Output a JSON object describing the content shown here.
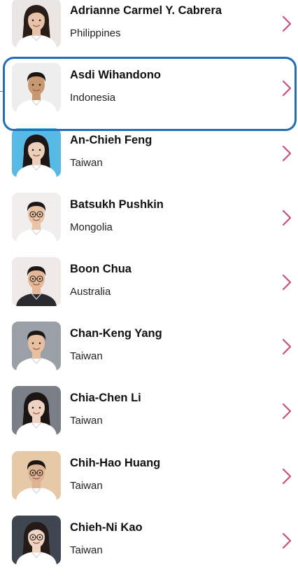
{
  "people": [
    {
      "name": "Adrianne Carmel Y. Cabrera",
      "country": "Philippines",
      "bg": "#e9e6e4",
      "skin": "#e6c3a9",
      "hair": "#2a1d18",
      "shirt": "#ffffff",
      "longhair": true,
      "glasses": false
    },
    {
      "name": "Asdi Wihandono",
      "country": "Indonesia",
      "bg": "#eeeeee",
      "skin": "#c89870",
      "hair": "#1a1413",
      "shirt": "#ffffff",
      "longhair": false,
      "glasses": false
    },
    {
      "name": "An-Chieh Feng",
      "country": "Taiwan",
      "bg": "#57b9e6",
      "skin": "#edd0bb",
      "hair": "#1d1614",
      "shirt": "#ffffff",
      "longhair": true,
      "glasses": false
    },
    {
      "name": "Batsukh Pushkin",
      "country": "Mongolia",
      "bg": "#f1efed",
      "skin": "#e8c3a5",
      "hair": "#1d1615",
      "shirt": "#ffffff",
      "longhair": false,
      "glasses": true
    },
    {
      "name": "Boon Chua",
      "country": "Australia",
      "bg": "#efe9e8",
      "skin": "#e5b898",
      "hair": "#1e1716",
      "shirt": "#2a2a30",
      "longhair": false,
      "glasses": true
    },
    {
      "name": "Chan-Keng Yang",
      "country": "Taiwan",
      "bg": "#9aa0a6",
      "skin": "#e7c0a2",
      "hair": "#1c1615",
      "shirt": "#ffffff",
      "longhair": false,
      "glasses": false
    },
    {
      "name": "Chia-Chen Li",
      "country": "Taiwan",
      "bg": "#7a7f87",
      "skin": "#efd2c2",
      "hair": "#1b1514",
      "shirt": "#ffffff",
      "longhair": true,
      "glasses": false
    },
    {
      "name": "Chih-Hao Huang",
      "country": "Taiwan",
      "bg": "#e6c9a6",
      "skin": "#deb392",
      "hair": "#1b1514",
      "shirt": "#ffffff",
      "longhair": false,
      "glasses": true
    },
    {
      "name": "Chieh-Ni Kao",
      "country": "Taiwan",
      "bg": "#3f4650",
      "skin": "#efd4c3",
      "hair": "#241b18",
      "shirt": "#ffffff",
      "longhair": true,
      "glasses": true
    }
  ],
  "chevron_color": "#c9507a",
  "highlight_color": "#1f6fb8",
  "highlighted_index": 1
}
